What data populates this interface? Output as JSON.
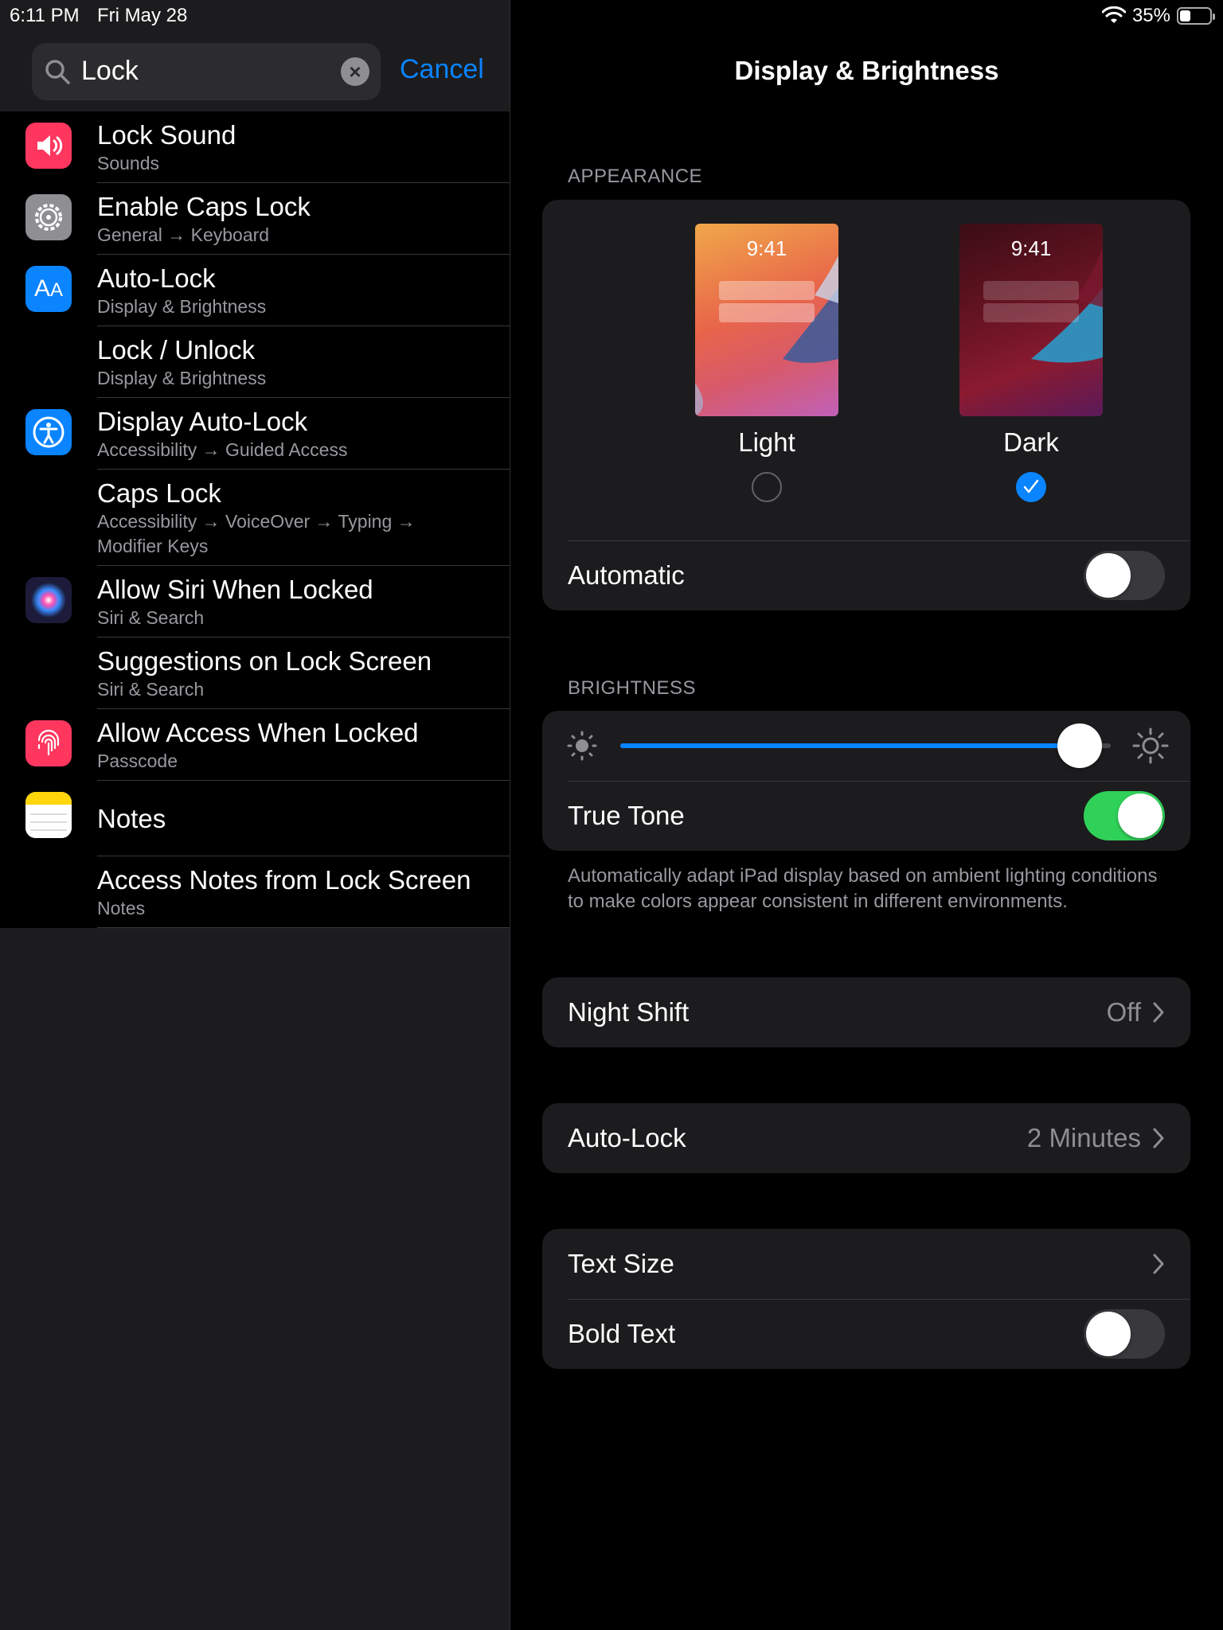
{
  "status_bar": {
    "time": "6:11 PM",
    "date": "Fri May 28",
    "battery": "35%",
    "battery_level": 0.35
  },
  "search": {
    "query": "Lock",
    "cancel_label": "Cancel"
  },
  "results": [
    {
      "title": "Lock Sound",
      "subtitle": "Sounds",
      "icon": "speaker-icon",
      "icon_color": "#ff375f"
    },
    {
      "title": "Enable Caps Lock",
      "subtitle": "General → Keyboard",
      "icon": "gear-icon",
      "icon_color": "#8e8e93"
    },
    {
      "title": "Auto-Lock",
      "subtitle": "Display & Brightness",
      "icon": "text-size-icon",
      "icon_color": "#0a84ff"
    },
    {
      "title": "Lock / Unlock",
      "subtitle": "Display & Brightness",
      "icon": "",
      "icon_color": ""
    },
    {
      "title": "Display Auto-Lock",
      "subtitle": "Accessibility → Guided Access",
      "icon": "accessibility-icon",
      "icon_color": "#0a84ff"
    },
    {
      "title": "Caps Lock",
      "subtitle": "Accessibility → VoiceOver → Typing → Modifier Keys",
      "icon": "",
      "icon_color": ""
    },
    {
      "title": "Allow Siri When Locked",
      "subtitle": "Siri & Search",
      "icon": "siri-icon",
      "icon_color": "#1c1c3a"
    },
    {
      "title": "Suggestions on Lock Screen",
      "subtitle": "Siri & Search",
      "icon": "",
      "icon_color": ""
    },
    {
      "title": "Allow Access When Locked",
      "subtitle": "Passcode",
      "icon": "fingerprint-icon",
      "icon_color": "#ff375f"
    },
    {
      "title": "Notes",
      "subtitle": "",
      "icon": "notes-icon",
      "icon_color": "#ffffff"
    },
    {
      "title": "Access Notes from Lock Screen",
      "subtitle": "Notes",
      "icon": "",
      "icon_color": ""
    }
  ],
  "detail": {
    "title": "Display & Brightness",
    "appearance": {
      "header": "APPEARANCE",
      "light": {
        "label": "Light",
        "preview_time": "9:41",
        "selected": false
      },
      "dark": {
        "label": "Dark",
        "preview_time": "9:41",
        "selected": true
      },
      "automatic": {
        "label": "Automatic",
        "on": false
      }
    },
    "brightness": {
      "header": "BRIGHTNESS",
      "level": 0.98,
      "true_tone": {
        "label": "True Tone",
        "on": true
      },
      "footer": "Automatically adapt iPad display based on ambient lighting conditions to make colors appear consistent in different environments."
    },
    "night_shift": {
      "label": "Night Shift",
      "value": "Off"
    },
    "auto_lock": {
      "label": "Auto-Lock",
      "value": "2 Minutes"
    },
    "text_size": {
      "label": "Text Size"
    },
    "bold_text": {
      "label": "Bold Text",
      "on": false
    }
  },
  "colors": {
    "accent": "#0a84ff",
    "toggle_on": "#30d158",
    "group_bg": "#1c1c1e"
  }
}
